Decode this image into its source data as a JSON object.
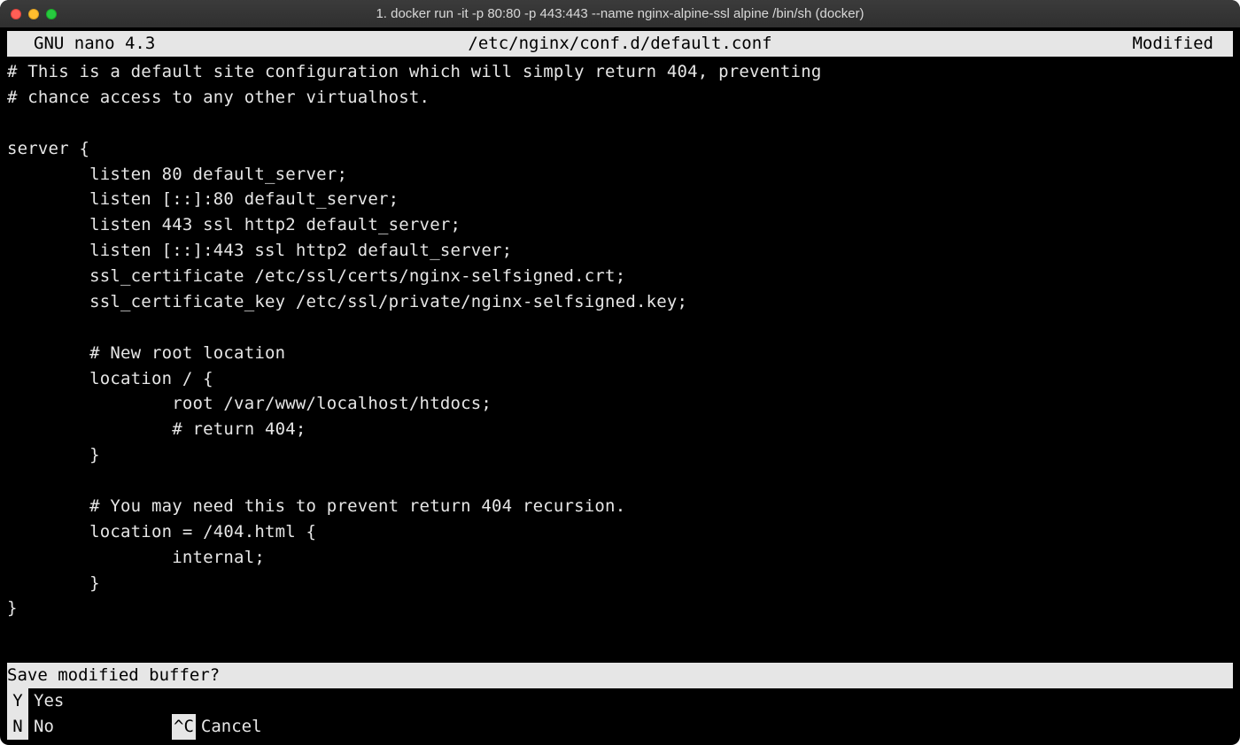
{
  "titlebar": {
    "title": "1. docker run -it -p 80:80 -p 443:443 --name nginx-alpine-ssl alpine /bin/sh (docker)"
  },
  "nano": {
    "app_label": "GNU nano 4.3",
    "file_path": "/etc/nginx/conf.d/default.conf",
    "status": "Modified"
  },
  "editor_lines": [
    "# This is a default site configuration which will simply return 404, preventing",
    "# chance access to any other virtualhost.",
    "",
    "server {",
    "        listen 80 default_server;",
    "        listen [::]:80 default_server;",
    "        listen 443 ssl http2 default_server;",
    "        listen [::]:443 ssl http2 default_server;",
    "        ssl_certificate /etc/ssl/certs/nginx-selfsigned.crt;",
    "        ssl_certificate_key /etc/ssl/private/nginx-selfsigned.key;",
    "",
    "        # New root location",
    "        location / {",
    "                root /var/www/localhost/htdocs;",
    "                # return 404;",
    "        }",
    "",
    "        # You may need this to prevent return 404 recursion.",
    "        location = /404.html {",
    "                internal;",
    "        }",
    "}"
  ],
  "prompt": "Save modified buffer?",
  "shortcuts": {
    "yes": {
      "key": " Y",
      "label": "Yes"
    },
    "no": {
      "key": " N",
      "label": "No"
    },
    "cancel": {
      "key": "^C",
      "label": "Cancel"
    }
  }
}
